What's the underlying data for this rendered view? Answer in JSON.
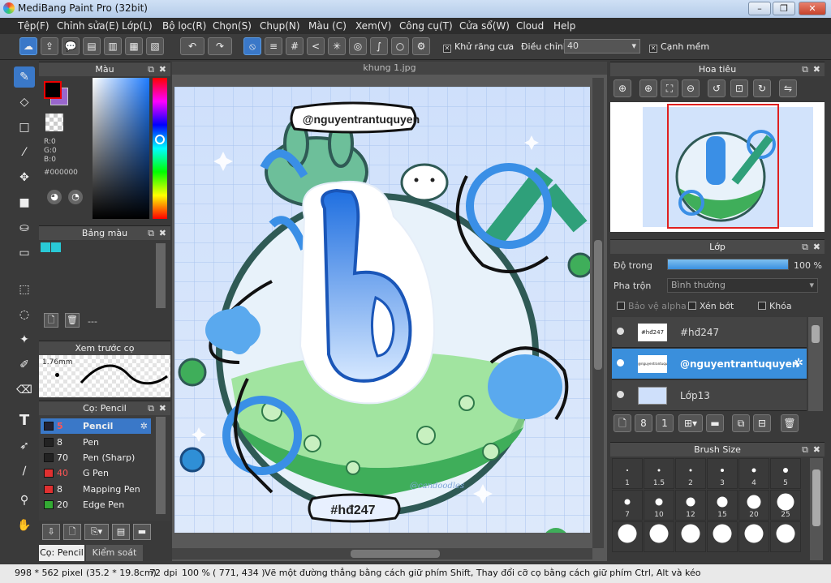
{
  "window": {
    "title": "MediBang Paint Pro (32bit)"
  },
  "menu": [
    "Tệp(F)",
    "Chỉnh sửa(E)",
    "Lớp(L)",
    "Bộ lọc(R)",
    "Chọn(S)",
    "Chụp(N)",
    "Màu (C)",
    "Xem(V)",
    "Công cụ(T)",
    "Cửa sổ(W)",
    "Cloud",
    "Help"
  ],
  "toolbar": {
    "antialias_label": "Khử răng cưa",
    "adjust_label": "Điều chỉnh",
    "adjust_value": "40",
    "edge_label": "Cạnh mềm"
  },
  "color_panel": {
    "title": "Màu",
    "rgb": [
      "R:0",
      "G:0",
      "B:0"
    ],
    "hex": "#000000",
    "fg_color": "#000000",
    "bg_color": "#9966cc"
  },
  "palette_panel": {
    "title": "Bảng màu",
    "swatches": [
      "#29c9d6",
      "#29c9d6"
    ],
    "value": "---"
  },
  "preview_panel": {
    "title": "Xem trước cọ",
    "size": "1.76mm"
  },
  "brush_panel": {
    "title": "Cọ: Pencil",
    "brushes": [
      {
        "size": "5",
        "name": "Pencil",
        "color": "#222222"
      },
      {
        "size": "8",
        "name": "Pen",
        "color": "#222222"
      },
      {
        "size": "70",
        "name": "Pen (Sharp)",
        "color": "#222222"
      },
      {
        "size": "40",
        "name": "G Pen",
        "color": "#e03030"
      },
      {
        "size": "8",
        "name": "Mapping Pen",
        "color": "#e03030"
      },
      {
        "size": "20",
        "name": "Edge Pen",
        "color": "#33aa33"
      }
    ],
    "tabs": [
      "Cọ: Pencil",
      "Kiểm soát cọ"
    ]
  },
  "canvas": {
    "tab": "khung 1.jpg",
    "tag_top": "@nguyentrantuquyen",
    "tag_bottom": "#hđ247",
    "big_letter": "b",
    "faint_signature": "@candoodles"
  },
  "navigator": {
    "title": "Hoa tiêu"
  },
  "layer_panel": {
    "title": "Lớp",
    "opacity_label": "Độ trong",
    "opacity_value": "100 %",
    "opacity_fraction": 1.0,
    "blend_label": "Pha trộn",
    "blend_value": "Bình thường",
    "alpha_label": "Bảo vệ alpha",
    "clip_label": "Xén bớt",
    "lock_label": "Khóa",
    "layers": [
      {
        "name": "#hđ247",
        "thumb": "#hđ247"
      },
      {
        "name": "@nguyentrantuquyen",
        "thumb": "@nguyentrantuquyen"
      },
      {
        "name": "Lớp13",
        "thumb": ""
      }
    ]
  },
  "brush_size_panel": {
    "title": "Brush Size",
    "sizes": [
      "1",
      "1.5",
      "2",
      "3",
      "4",
      "5",
      "7",
      "10",
      "12",
      "15",
      "20",
      "25",
      "",
      "",
      "",
      "",
      "",
      ""
    ]
  },
  "status": {
    "dims": "998 * 562 pixel",
    "cm": "(35.2 * 19.8cm)",
    "dpi": "72 dpi",
    "zoom": "100 %",
    "coords": "( 771, 434 )",
    "hint": "Vẽ một đường thẳng bằng cách giữ phím Shift, Thay đổi cỡ cọ bằng cách giữ phím Ctrl, Alt và kéo"
  }
}
